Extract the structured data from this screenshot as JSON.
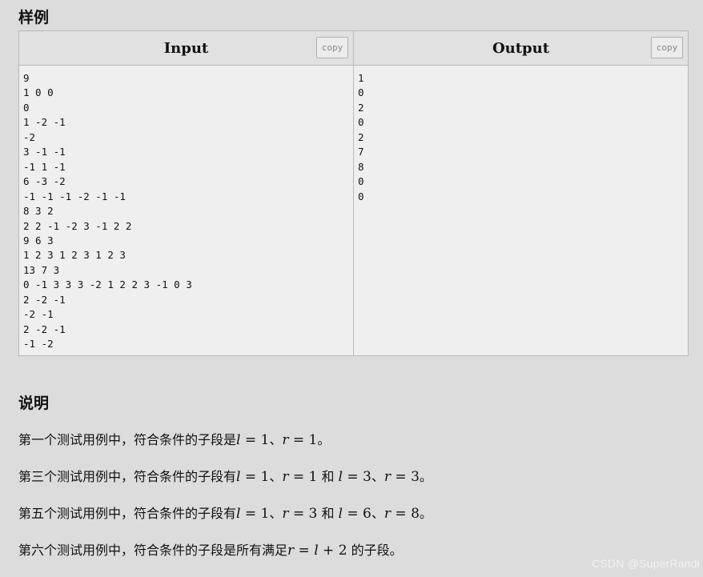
{
  "sample": {
    "heading": "样例",
    "input": {
      "title": "Input",
      "copy_label": "copy",
      "lines": [
        "9",
        "1 0 0",
        "0",
        "1 -2 -1",
        "-2",
        "3 -1 -1",
        "-1 1 -1",
        "6 -3 -2",
        "-1 -1 -1 -2 -1 -1",
        "8 3 2",
        "2 2 -1 -2 3 -1 2 2",
        "9 6 3",
        "1 2 3 1 2 3 1 2 3",
        "13 7 3",
        "0 -1 3 3 3 -2 1 2 2 3 -1 0 3",
        "2 -2 -1",
        "-2 -1",
        "2 -2 -1",
        "-1 -2"
      ]
    },
    "output": {
      "title": "Output",
      "copy_label": "copy",
      "lines": [
        "1",
        "0",
        "2",
        "0",
        "2",
        "7",
        "8",
        "0",
        "0"
      ]
    }
  },
  "note": {
    "heading": "说明",
    "p1": {
      "t1": "第一个测试用例中，符合条件的子段是",
      "l": "l",
      "eq1": " = 1",
      "sep": "、",
      "r": "r",
      "eq2": " = 1",
      "end": "。"
    },
    "p2": {
      "t1": "第三个测试用例中，符合条件的子段有",
      "l": "l",
      "eq1": " = 1",
      "sep1": "、",
      "r": "r",
      "eq2": " = 1",
      "and": " 和 ",
      "l2": "l",
      "eq3": " = 3",
      "sep2": "、",
      "r2": "r",
      "eq4": " = 3",
      "end": "。"
    },
    "p3": {
      "t1": "第五个测试用例中，符合条件的子段有",
      "l": "l",
      "eq1": " = 1",
      "sep1": "、",
      "r": "r",
      "eq2": " = 3",
      "and": " 和 ",
      "l2": "l",
      "eq3": " = 6",
      "sep2": "、",
      "r2": "r",
      "eq4": " = 8",
      "end": "。"
    },
    "p4": {
      "t1": "第六个测试用例中，符合条件的子段是所有满足",
      "r": "r",
      "eq": " = ",
      "l": "l",
      "plus": " + 2",
      "end": " 的子段。"
    }
  },
  "watermark": "CSDN @SuperRandi"
}
